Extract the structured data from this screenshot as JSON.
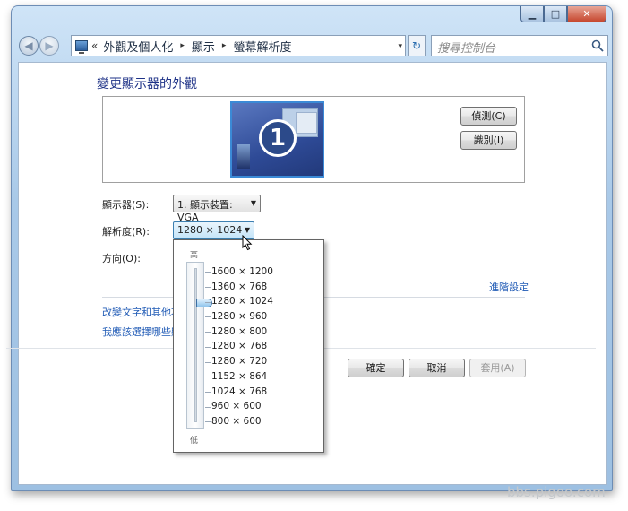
{
  "window": {
    "caption_buttons": {
      "minimize": "▁",
      "maximize": "□",
      "close": "✕"
    }
  },
  "navbar": {
    "back_glyph": "◀",
    "forward_glyph": "▶",
    "address_lead": "«",
    "breadcrumbs": [
      "外觀及個人化",
      "顯示",
      "螢幕解析度"
    ],
    "separator": "▸",
    "dropdown_glyph": "▾",
    "refresh_glyph": "↻",
    "search_placeholder": "搜尋控制台"
  },
  "main": {
    "heading": "變更顯示器的外觀",
    "monitor_number": "1",
    "detect_button": "偵測(C)",
    "identify_button": "識別(I)",
    "display_label": "顯示器(S):",
    "display_value": "1. 顯示裝置: VGA",
    "resolution_label": "解析度(R):",
    "resolution_value": "1280 × 1024",
    "orientation_label": "方向(O):",
    "advanced_link": "進階設定",
    "text_size_link": "改變文字和其他項",
    "which_link": "我應該選擇哪些顯",
    "ok_button": "確定",
    "cancel_button": "取消",
    "apply_button": "套用(A)"
  },
  "resolution_popup": {
    "high_label": "高",
    "low_label": "低",
    "slider_level": "1280 × 1024",
    "options": [
      "1600 × 1200",
      "1360 × 768",
      "1280 × 1024",
      "1280 × 960",
      "1280 × 800",
      "1280 × 768",
      "1280 × 720",
      "1152 × 864",
      "1024 × 768",
      "960 × 600",
      "800 × 600"
    ]
  },
  "watermark": "bbs.pigoo.com",
  "colors": {
    "link": "#1f5ab5",
    "heading": "#1e3287",
    "frame": "#a9c9e8"
  }
}
